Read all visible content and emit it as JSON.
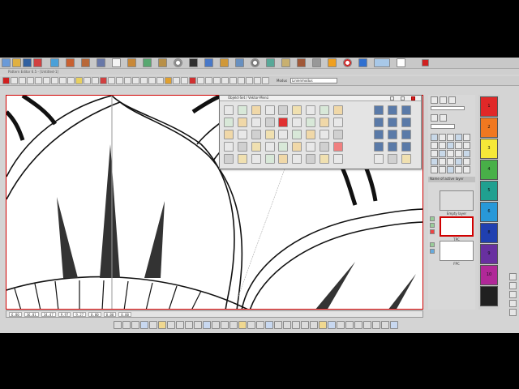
{
  "app": {
    "title": "Pattern Editor 6.5 - [Untitled-1]",
    "mode_label": "Modus",
    "mode_value": "Linienmodus"
  },
  "top_toolbar": {
    "buttons": [
      "new",
      "open",
      "save",
      "print",
      "pattern-1",
      "pattern-2",
      "pattern-3",
      "pattern-4",
      "blank",
      "pattern-5",
      "pattern-6",
      "pattern-7",
      "target-1",
      "pattern-8",
      "pattern-9",
      "pattern-10",
      "pattern-11",
      "target-2",
      "pattern-12",
      "pattern-13",
      "pattern-14",
      "pattern-15",
      "fire",
      "circle",
      "pen",
      "wave",
      "dot"
    ]
  },
  "palette": {
    "title": "Objekt-Set / Vektor-Menü"
  },
  "status": {
    "x": "6.80",
    "y": "36.81",
    "w": "34.47",
    "h": "9.97",
    "a": "9.27",
    "b": "0.00",
    "c": "0.00",
    "d": "0.00"
  },
  "layers": {
    "title": "Name of active layer",
    "items": [
      {
        "label": "Empty layer"
      },
      {
        "label": "TPC"
      },
      {
        "label": "FPC"
      }
    ]
  },
  "swatches": [
    {
      "number": "1",
      "color": "#e02828"
    },
    {
      "number": "2",
      "color": "#f07820"
    },
    {
      "number": "3",
      "color": "#f5e838"
    },
    {
      "number": "4",
      "color": "#48b048"
    },
    {
      "number": "5",
      "color": "#20a090"
    },
    {
      "number": "6",
      "color": "#2898d8"
    },
    {
      "number": "8",
      "color": "#2040b0"
    },
    {
      "number": "9",
      "color": "#6830a0"
    },
    {
      "number": "10",
      "color": "#b02898"
    },
    {
      "number": "",
      "color": "#202020"
    }
  ]
}
